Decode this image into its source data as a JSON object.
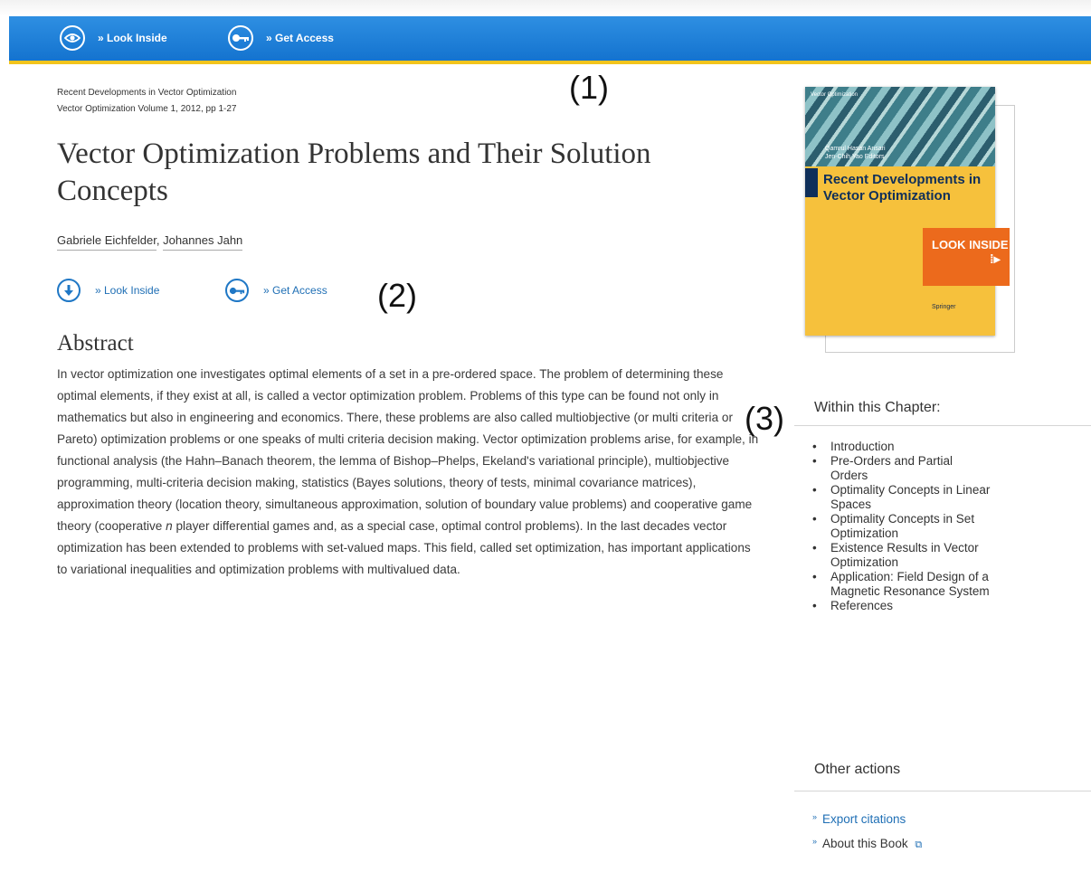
{
  "topbar": {
    "look_inside": "» Look Inside",
    "get_access": "» Get Access"
  },
  "annotations": {
    "one": "(1)",
    "two": "(2)",
    "three": "(3)"
  },
  "breadcrumb": {
    "book": "Recent Developments in Vector Optimization",
    "series": "Vector Optimization Volume 1, 2012, pp 1-27"
  },
  "chapter": {
    "title": "Vector Optimization Problems and Their Solution Concepts",
    "authors": [
      "Gabriele Eichfelder",
      "Johannes Jahn"
    ],
    "author_separator": ","
  },
  "body_actions": {
    "look_inside": "» Look Inside",
    "get_access": "» Get Access"
  },
  "abstract": {
    "heading": "Abstract",
    "text_before_italic": "In vector optimization one investigates optimal elements of a set in a pre-ordered space. The problem of determining these optimal elements, if they exist at all, is called a vector optimization problem. Problems of this type can be found not only in mathematics but also in engineering and economics. There, these problems are also called multiobjective (or multi criteria or Pareto) optimization problems or one speaks of multi criteria decision making. Vector optimization problems arise, for example, in functional analysis (the Hahn–Banach theorem, the lemma of Bishop–Phelps, Ekeland's variational principle), multiobjective programming, multi-criteria decision making, statistics (Bayes solutions, theory of tests, minimal covariance matrices), approximation theory (location theory, simultaneous approximation, solution of boundary value problems) and cooperative game theory (cooperative ",
    "italic": "n",
    "text_after_italic": " player differential games and, as a special case, optimal control problems). In the last decades vector optimization has been extended to problems with set-valued maps. This field, called set optimization, has important applications to variational inequalities and optimization problems with multivalued data."
  },
  "cover": {
    "series": "Vector Optimization",
    "editors": [
      "Qamrul Hasan Ansari",
      "Jen-Chih Yao  Editors"
    ],
    "title": "Recent Developments in Vector Optimization",
    "publisher": "Springer",
    "badge": "LOOK INSIDE",
    "badge_arrow": "⁞▸"
  },
  "sidebar": {
    "within_heading": "Within this Chapter:",
    "toc": [
      "Introduction",
      "Pre-Orders and Partial Orders",
      "Optimality Concepts in Linear Spaces",
      "Optimality Concepts in Set Optimization",
      "Existence Results in Vector Optimization",
      "Application: Field Design of a Magnetic Resonance System",
      "References"
    ],
    "other_heading": "Other actions",
    "export": "Export citations",
    "about": "About this Book",
    "link_chevron": "»",
    "external_icon": "⧉"
  },
  "colors": {
    "topbar": "#1a7bd5",
    "topbar_border": "#f2c41c",
    "link": "#1f6fb5",
    "badge": "#ec6a1c",
    "cover": "#f6c13c"
  }
}
